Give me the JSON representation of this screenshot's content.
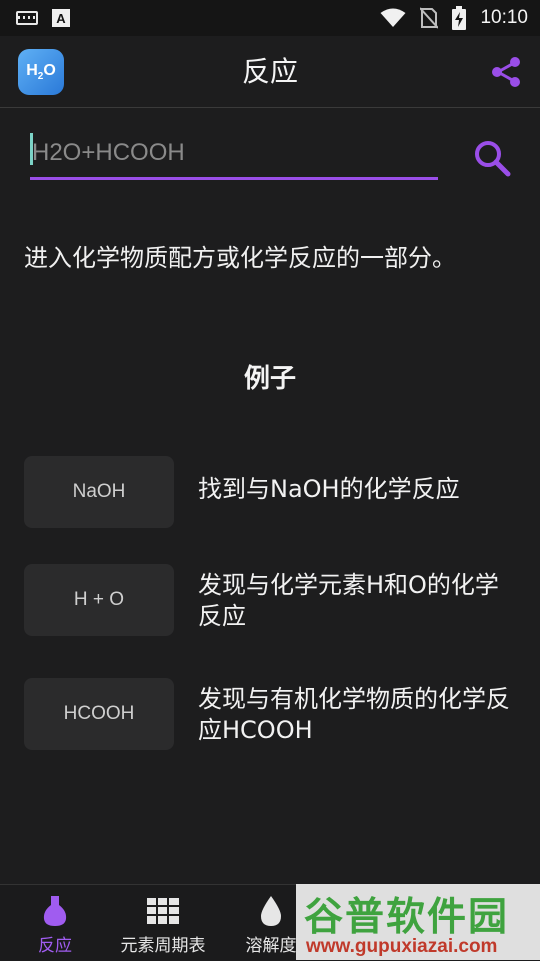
{
  "status_bar": {
    "time": "10:10",
    "left_icons": [
      "keyboard-icon",
      "a-notification-icon"
    ],
    "right_icons": [
      "wifi-icon",
      "no-sim-icon",
      "battery-charging-icon"
    ]
  },
  "app_bar": {
    "logo_text": "H2O",
    "title": "反应",
    "share_icon": "share-icon"
  },
  "search": {
    "placeholder": "H2O+HCOOH",
    "value": "",
    "button_icon": "search-icon"
  },
  "instruction": "进入化学物质配方或化学反应的一部分。",
  "examples": {
    "title": "例子",
    "items": [
      {
        "chip": "NaOH",
        "description": "找到与NaOH的化学反应"
      },
      {
        "chip": "H + O",
        "description": "发现与化学元素H和O的化学反应"
      },
      {
        "chip": "HCOOH",
        "description": "发现与有机化学物质的化学反应HCOOH"
      }
    ]
  },
  "bottom_nav": {
    "items": [
      {
        "label": "反应",
        "icon": "flask-icon",
        "active": true
      },
      {
        "label": "元素周期表",
        "icon": "grid-icon",
        "active": false
      },
      {
        "label": "溶解度",
        "icon": "drop-icon",
        "active": false
      }
    ]
  },
  "watermark": {
    "title": "谷普软件园",
    "url": "www.gupuxiazai.com"
  },
  "colors": {
    "accent": "#9a4ee8",
    "background": "#1d1d1e",
    "chip_background": "#2b2b2c",
    "caret": "#7cd3c7"
  }
}
